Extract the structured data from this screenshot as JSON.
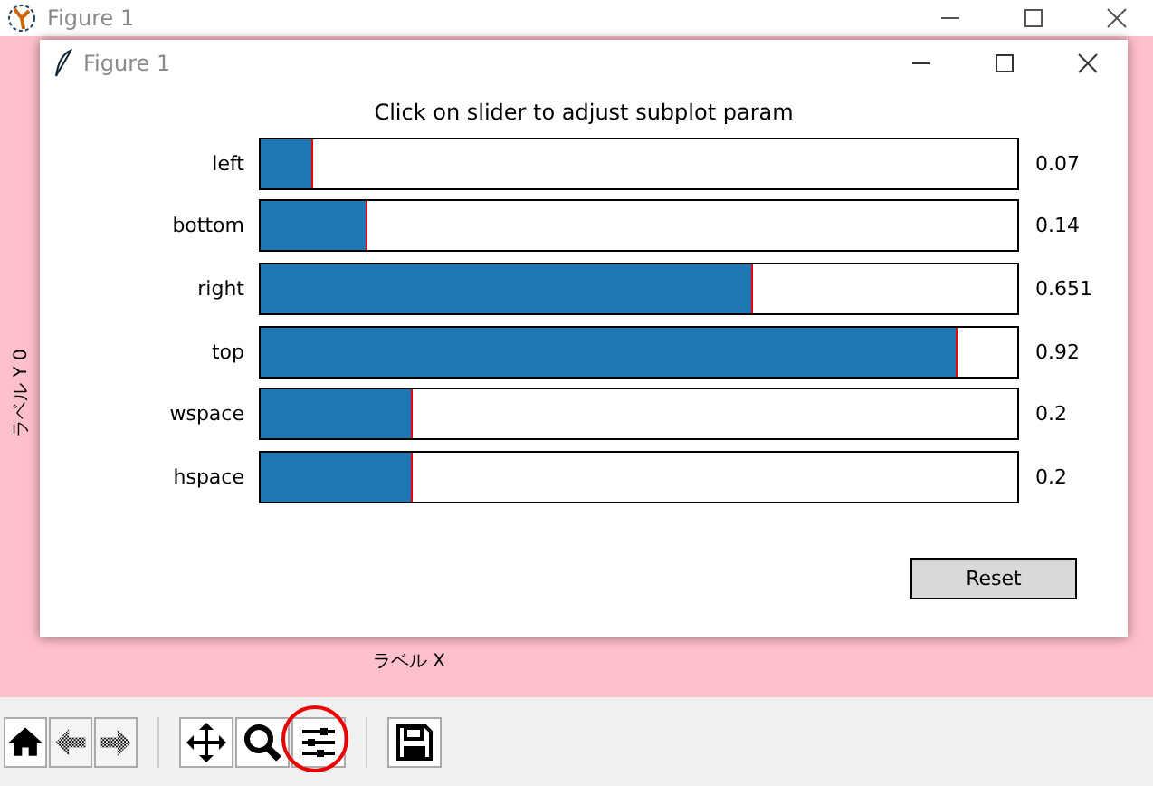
{
  "window": {
    "title": "Figure 1"
  },
  "plot": {
    "ylabel": "ラベル Y 0",
    "xlabel": "ラベル X"
  },
  "dialog": {
    "title": "Figure 1",
    "heading": "Click on slider to adjust subplot param",
    "sliders": [
      {
        "label": "left",
        "level": 0.07,
        "reading": "0.07"
      },
      {
        "label": "bottom",
        "level": 0.14,
        "reading": "0.14"
      },
      {
        "label": "right",
        "level": 0.651,
        "reading": "0.651"
      },
      {
        "label": "top",
        "level": 0.92,
        "reading": "0.92"
      },
      {
        "label": "wspace",
        "level": 0.2,
        "reading": "0.2"
      },
      {
        "label": "hspace",
        "level": 0.2,
        "reading": "0.2"
      }
    ],
    "reset_button": "Reset"
  },
  "toolbar": [
    {
      "kind": "home",
      "disabled": false,
      "highlighted": false
    },
    {
      "kind": "back",
      "disabled": true,
      "highlighted": false
    },
    {
      "kind": "forward",
      "disabled": true,
      "highlighted": false
    },
    {
      "kind": "separator"
    },
    {
      "kind": "pan",
      "disabled": false,
      "highlighted": false
    },
    {
      "kind": "zoom",
      "disabled": false,
      "highlighted": false
    },
    {
      "kind": "subplots",
      "disabled": false,
      "highlighted": true
    },
    {
      "kind": "separator"
    },
    {
      "kind": "save",
      "disabled": false,
      "highlighted": false
    }
  ]
}
